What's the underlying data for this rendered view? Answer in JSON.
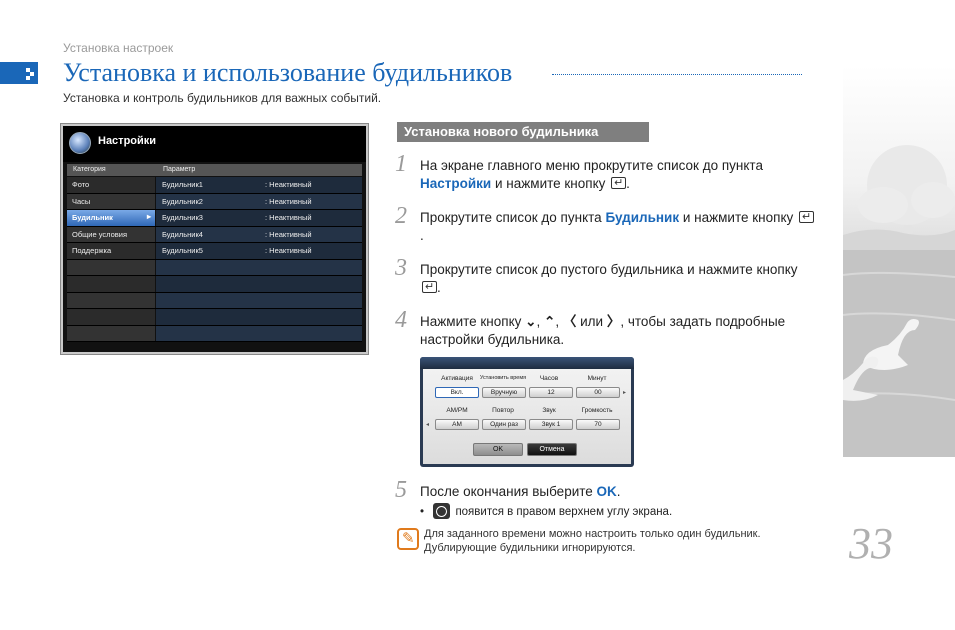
{
  "header": {
    "breadcrumb": "Установка настроек",
    "title": "Установка и использование будильников",
    "subtitle": "Установка и контроль будильников для важных событий."
  },
  "tv": {
    "title": "Настройки",
    "col_category": "Категория",
    "col_param": "Параметр",
    "rows": [
      {
        "cat": "Фото",
        "param": "Будильник1",
        "status": ": Неактивный"
      },
      {
        "cat": "Часы",
        "param": "Будильник2",
        "status": ": Неактивный"
      },
      {
        "cat": "Будильник",
        "param": "Будильник3",
        "status": ": Неактивный"
      },
      {
        "cat": "Общие условия",
        "param": "Будильник4",
        "status": ": Неактивный"
      },
      {
        "cat": "Поддержка",
        "param": "Будильник5",
        "status": ": Неактивный"
      }
    ]
  },
  "section": {
    "label": "Установка нового будильника"
  },
  "steps": {
    "s1": {
      "num": "1",
      "a": "На экране главного меню прокрутите список до пункта",
      "hl": "Настройки",
      "b": "и нажмите кнопку",
      "c": "."
    },
    "s2": {
      "num": "2",
      "a": "Прокрутите список до пункта",
      "hl": "Будильник",
      "b": "и нажмите кнопку",
      "c": "."
    },
    "s3": {
      "num": "3",
      "a": "Прокрутите список до пустого будильника и нажмите кнопку",
      "c": "."
    },
    "s4": {
      "num": "4",
      "a": "Нажмите кнопку",
      "g1": "⌄",
      "sep1": ",",
      "g2": "⌃",
      "sep2": ",",
      "g3": "〈",
      "or": "или",
      "g4": "〉",
      "b": ", чтобы задать подробные настройки будильника."
    },
    "s5": {
      "num": "5",
      "a": "После окончания выберите",
      "hl": "OK",
      "c": "."
    }
  },
  "dialog": {
    "labels": [
      "Активация",
      "Установить время",
      "Часов",
      "Минут",
      "AM/PM",
      "Повтор",
      "Звук",
      "Громкость"
    ],
    "values": [
      "Вкл.",
      "Вручную",
      "12",
      "00",
      "AM",
      "Один раз",
      "Звук 1",
      "70"
    ],
    "ok": "OK",
    "cancel": "Отмена"
  },
  "bullet": {
    "mark": "•",
    "text": "появится в правом верхнем углу экрана."
  },
  "note": {
    "line1": "Для заданного времени можно настроить только один будильник.",
    "line2": "Дублирующие будильники игнорируются."
  },
  "page_number": "33",
  "colors": {
    "accent": "#1a67b8",
    "note": "#e07a1c",
    "section_bg": "#7f7f7f"
  }
}
